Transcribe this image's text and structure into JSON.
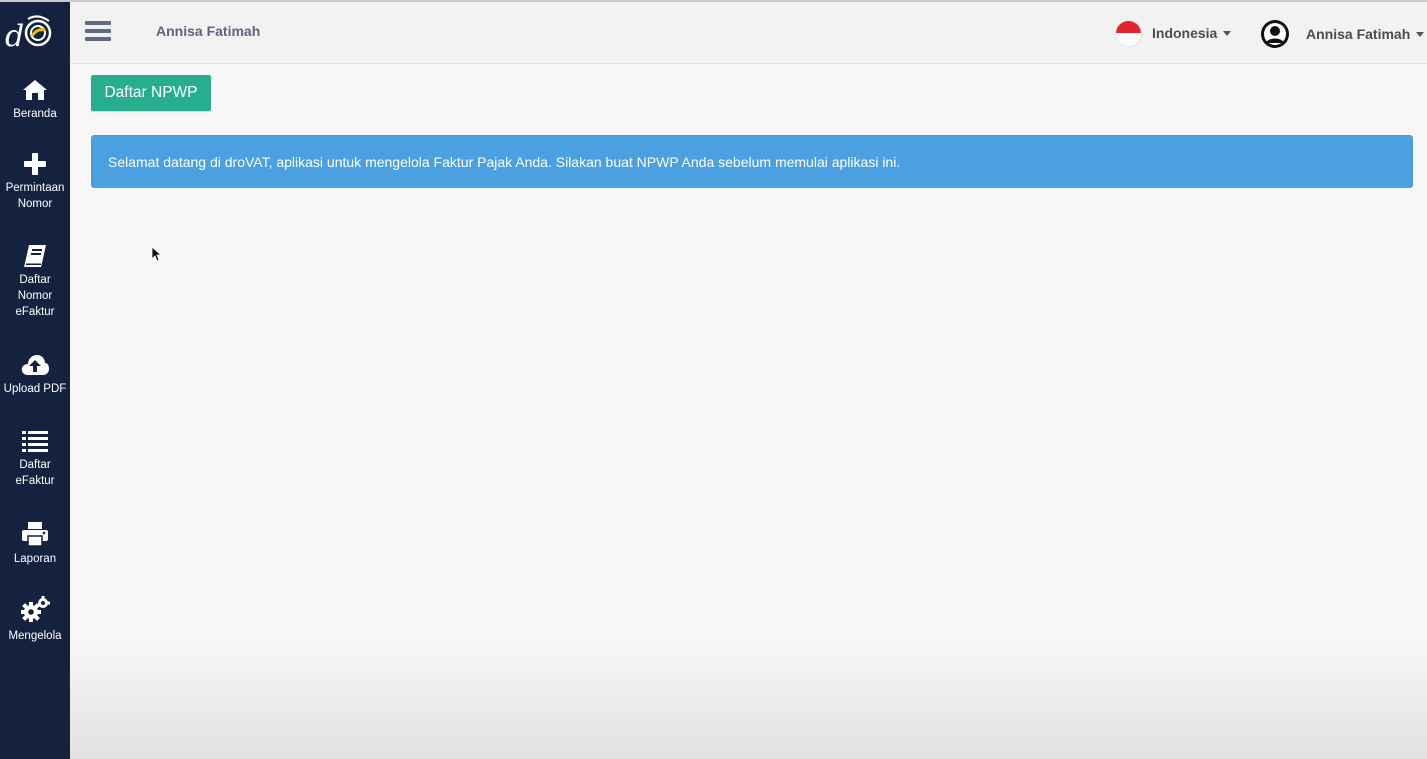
{
  "sidebar": {
    "logo_icon": "drovat-logo-icon",
    "items": [
      {
        "label": "Beranda",
        "icon": "home-icon"
      },
      {
        "label": "Permintaan Nomor",
        "icon": "plus-icon"
      },
      {
        "label": "Daftar Nomor eFaktur",
        "icon": "book-icon"
      },
      {
        "label": "Upload PDF",
        "icon": "cloud-upload-icon"
      },
      {
        "label": "Daftar eFaktur",
        "icon": "list-icon"
      },
      {
        "label": "Laporan",
        "icon": "print-icon"
      },
      {
        "label": "Mengelola",
        "icon": "gears-icon"
      }
    ]
  },
  "header": {
    "title": "Annisa Fatimah",
    "language": "Indonesia",
    "user_name": "Annisa Fatimah"
  },
  "main": {
    "register_button": "Daftar NPWP",
    "alert_text": "Selamat datang di droVAT, aplikasi untuk mengelola Faktur Pajak Anda. Silakan buat NPWP Anda sebelum memulai aplikasi ini."
  },
  "colors": {
    "sidebar_bg": "#14213f",
    "button_green": "#27ae8f",
    "alert_blue": "#4aa0e0"
  }
}
